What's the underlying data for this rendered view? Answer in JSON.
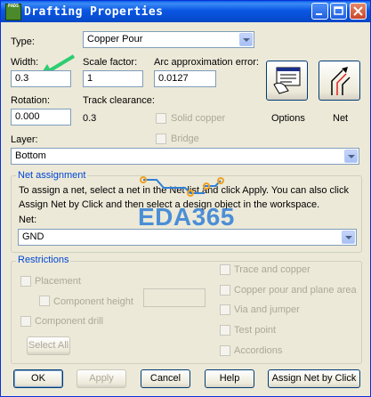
{
  "window": {
    "title": "Drafting Properties",
    "icon_text": "PADS"
  },
  "fields": {
    "type": {
      "label": "Type:",
      "value": "Copper Pour"
    },
    "width": {
      "label": "Width:",
      "value": "0.3"
    },
    "scale_factor": {
      "label": "Scale factor:",
      "value": "1"
    },
    "arc_error": {
      "label": "Arc approximation error:",
      "value": "0.0127"
    },
    "rotation": {
      "label": "Rotation:",
      "value": "0.000"
    },
    "track_clearance": {
      "label": "Track clearance:",
      "value": "0.3"
    },
    "solid_copper": {
      "label": "Solid copper"
    },
    "bridge": {
      "label": "Bridge"
    },
    "layer": {
      "label": "Layer:",
      "value": "Bottom"
    }
  },
  "buttons": {
    "options": "Options",
    "net": "Net"
  },
  "net_assignment": {
    "title": "Net assignment",
    "description_line1": "To assign a net, select a net in the Net list and click Apply. You can also click",
    "description_line2": "Assign Net by Click and then select a design object in the workspace.",
    "net_label": "Net:",
    "net_value": "GND"
  },
  "restrictions": {
    "title": "Restrictions",
    "placement": "Placement",
    "component_height": "Component height",
    "component_drill": "Component drill",
    "select_all": "Select All",
    "trace_and_copper": "Trace and copper",
    "copper_pour_plane": "Copper pour and plane area",
    "via_and_jumper": "Via and jumper",
    "test_point": "Test point",
    "accordions": "Accordions"
  },
  "footer": {
    "ok": "OK",
    "apply": "Apply",
    "cancel": "Cancel",
    "help": "Help",
    "assign_net": "Assign Net by Click"
  },
  "watermark": "EDA365",
  "colors": {
    "accent_arrow": "#2ecc71",
    "titlebar": "#0a56e3"
  }
}
